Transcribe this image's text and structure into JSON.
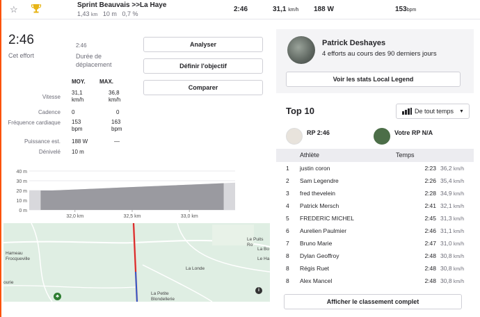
{
  "segment": {
    "name": "Sprint Beauvais >>La Haye",
    "distance_value": "1,43",
    "distance_unit": "km",
    "elevation": "10 m",
    "grade": "0,7 %",
    "time": "2:46",
    "speed_value": "31,1",
    "speed_unit": "km/h",
    "power": "188 W",
    "hr_value": "153",
    "hr_unit": "bpm"
  },
  "effort": {
    "time": "2:46",
    "label": "Cet effort",
    "duration_value": "2:46",
    "duration_label": "Durée de déplacement"
  },
  "actions": {
    "analyze": "Analyser",
    "set_goal": "Définir l'objectif",
    "compare": "Comparer"
  },
  "stats": {
    "avg_header": "MOY.",
    "max_header": "MAX.",
    "rows": [
      {
        "label": "Vitesse",
        "avg": "31,1",
        "avg_unit": "km/h",
        "max": "36,8",
        "max_unit": "km/h"
      },
      {
        "label": "Cadence",
        "avg": "0",
        "avg_unit": "",
        "max": "0",
        "max_unit": ""
      },
      {
        "label": "Fréquence cardiaque",
        "avg": "153",
        "avg_unit": "bpm",
        "max": "163",
        "max_unit": "bpm"
      },
      {
        "label": "Puissance est.",
        "avg": "188 W",
        "avg_unit": "",
        "max": "—",
        "max_unit": ""
      },
      {
        "label": "Dénivelé",
        "avg": "10 m",
        "avg_unit": "",
        "max": "",
        "max_unit": ""
      }
    ]
  },
  "chart_data": {
    "type": "area",
    "y_ticks": [
      "40 m",
      "30 m",
      "20 m",
      "10 m",
      "0 m"
    ],
    "x_ticks": [
      "32,0 km",
      "32,5 km",
      "33,0 km"
    ],
    "ylim": [
      0,
      40
    ],
    "x": [
      31.6,
      31.8,
      32.0,
      32.2,
      32.4,
      32.6,
      32.8,
      33.0,
      33.2,
      33.4
    ],
    "values": [
      20,
      20,
      21,
      22,
      23,
      24,
      25,
      26,
      27,
      28
    ],
    "segment_range": [
      31.7,
      33.3
    ]
  },
  "map": {
    "labels": [
      "Hameau Frocqueville",
      "La Londe",
      "La Petite Blondellerie",
      "Le Puits Ro",
      "La Bo",
      "Le Ha",
      "ourie"
    ]
  },
  "local_legend": {
    "name": "Patrick Deshayes",
    "subtitle": "4 efforts au cours des 90 derniers jours",
    "button": "Voir les stats Local Legend"
  },
  "top10": {
    "title": "Top 10",
    "filter": "De tout temps",
    "pr_label": "RP 2:46",
    "your_pr_label": "Votre RP N/A",
    "col_athlete": "Athlète",
    "col_time": "Temps",
    "rows": [
      {
        "rank": "1",
        "name": "justin coron",
        "time": "2:23",
        "speed": "36,2",
        "unit": "km/h"
      },
      {
        "rank": "2",
        "name": "Sam Legendre",
        "time": "2:26",
        "speed": "35,4",
        "unit": "km/h"
      },
      {
        "rank": "3",
        "name": "fred thevelein",
        "time": "2:28",
        "speed": "34,9",
        "unit": "km/h"
      },
      {
        "rank": "4",
        "name": "Patrick Mersch",
        "time": "2:41",
        "speed": "32,1",
        "unit": "km/h"
      },
      {
        "rank": "5",
        "name": "FREDERIC MICHEL",
        "time": "2:45",
        "speed": "31,3",
        "unit": "km/h"
      },
      {
        "rank": "6",
        "name": "Aurelien Paulmier",
        "time": "2:46",
        "speed": "31,1",
        "unit": "km/h"
      },
      {
        "rank": "7",
        "name": "Bruno Marie",
        "time": "2:47",
        "speed": "31,0",
        "unit": "km/h"
      },
      {
        "rank": "8",
        "name": "Dylan Geoffroy",
        "time": "2:48",
        "speed": "30,8",
        "unit": "km/h"
      },
      {
        "rank": "8",
        "name": "Régis Ruet",
        "time": "2:48",
        "speed": "30,8",
        "unit": "km/h"
      },
      {
        "rank": "8",
        "name": "Alex Mancel",
        "time": "2:48",
        "speed": "30,8",
        "unit": "km/h"
      }
    ],
    "full_button": "Afficher le classement complet"
  },
  "colors": {
    "accent": "#fc5200",
    "route": "#d62828"
  }
}
